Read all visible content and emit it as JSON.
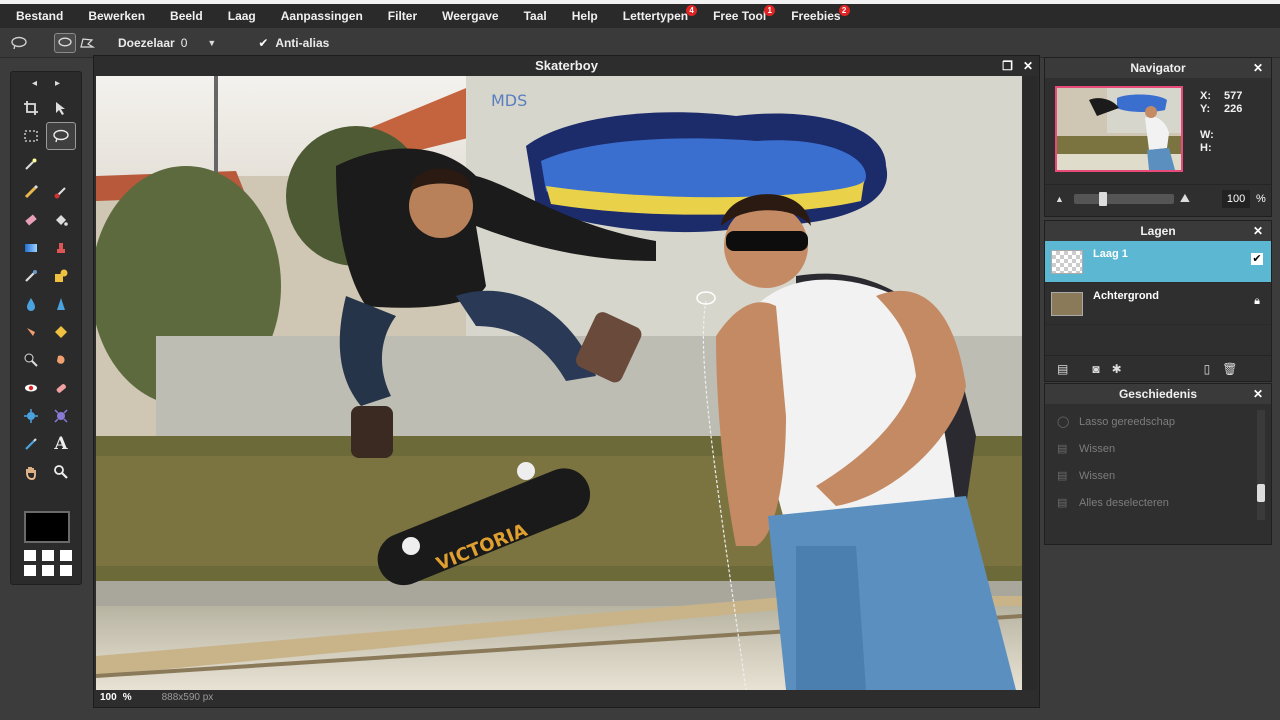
{
  "menu": [
    {
      "label": "Bestand"
    },
    {
      "label": "Bewerken"
    },
    {
      "label": "Beeld"
    },
    {
      "label": "Laag"
    },
    {
      "label": "Aanpassingen"
    },
    {
      "label": "Filter"
    },
    {
      "label": "Weergave"
    },
    {
      "label": "Taal"
    },
    {
      "label": "Help"
    },
    {
      "label": "Lettertypen",
      "badge": "4"
    },
    {
      "label": "Free Tool",
      "badge": "1"
    },
    {
      "label": "Freebies",
      "badge": "2"
    }
  ],
  "options": {
    "feather_label": "Doezelaar",
    "feather_value": "0",
    "antialias_label": "Anti-alias",
    "antialias_checked": true
  },
  "tools": {
    "nav_left": "◂",
    "nav_right": "▸"
  },
  "canvas": {
    "title": "Skaterboy",
    "zoom": "100",
    "zoom_unit": "%",
    "dimensions": "888x590 px"
  },
  "navigator": {
    "title": "Navigator",
    "x_label": "X:",
    "x_value": "577",
    "y_label": "Y:",
    "y_value": "226",
    "w_label": "W:",
    "w_value": "",
    "h_label": "H:",
    "h_value": "",
    "zoom_value": "100",
    "zoom_unit": "%"
  },
  "layers": {
    "title": "Lagen",
    "items": [
      {
        "name": "Laag 1",
        "active": true
      },
      {
        "name": "Achtergrond",
        "active": false
      }
    ]
  },
  "history": {
    "title": "Geschiedenis",
    "items": [
      {
        "label": "Lasso gereedschap"
      },
      {
        "label": "Wissen"
      },
      {
        "label": "Wissen"
      },
      {
        "label": "Alles deselecteren"
      }
    ]
  },
  "colors": {
    "active_layer": "#5bb7d2",
    "badge": "#e02424",
    "nav_frame": "#e84a7a"
  }
}
